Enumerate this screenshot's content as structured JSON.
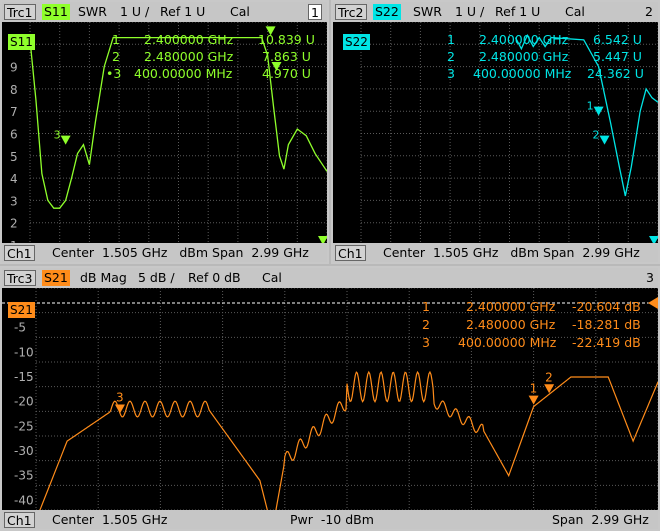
{
  "colors": {
    "s11": "#8fff2b",
    "s22": "#00e5e5",
    "s21": "#ff8c1a",
    "grid": "#5a5a5a",
    "axis": "#a0a0a0"
  },
  "p1": {
    "trace": "Trc1",
    "param": "S11",
    "format": "SWR",
    "scale": "1 U /",
    "ref": "Ref 1 U",
    "cal": "Cal",
    "num": "1",
    "badge": "S11",
    "markers": [
      {
        "id": "1",
        "freq": "2.400000 GHz",
        "val": "10.839 U"
      },
      {
        "id": "2",
        "freq": "2.480000 GHz",
        "val": "7.863 U"
      },
      {
        "id": "•3",
        "freq": "400.00000 MHz",
        "val": "4.970 U"
      }
    ],
    "ticks": [
      "9",
      "8",
      "7",
      "6",
      "5",
      "4",
      "3",
      "2",
      "1"
    ],
    "trace_points": [
      [
        0,
        10.2
      ],
      [
        0.02,
        7.5
      ],
      [
        0.04,
        4.2
      ],
      [
        0.06,
        3.0
      ],
      [
        0.08,
        2.65
      ],
      [
        0.1,
        2.65
      ],
      [
        0.12,
        3.0
      ],
      [
        0.14,
        4.0
      ],
      [
        0.16,
        5.1
      ],
      [
        0.18,
        5.5
      ],
      [
        0.2,
        4.6
      ],
      [
        0.22,
        6.5
      ],
      [
        0.25,
        9.0
      ],
      [
        0.28,
        10.3
      ],
      [
        0.78,
        10.3
      ],
      [
        0.8,
        9.5
      ],
      [
        0.82,
        7.2
      ],
      [
        0.84,
        5.0
      ],
      [
        0.855,
        4.4
      ],
      [
        0.87,
        5.5
      ],
      [
        0.9,
        6.2
      ],
      [
        0.93,
        5.9
      ],
      [
        0.96,
        5.1
      ],
      [
        0.99,
        4.5
      ],
      [
        1.0,
        4.3
      ]
    ],
    "marker_pos": [
      {
        "lbl": "",
        "x": 0.81,
        "y": 10.4
      },
      {
        "lbl": "",
        "x": 0.83,
        "y": 8.8
      },
      {
        "lbl": "3",
        "x": 0.12,
        "y": 5.5
      }
    ],
    "footer_ch": "Ch1",
    "footer": "Center  1.505 GHz   dBm Span  2.99 GHz"
  },
  "p2": {
    "trace": "Trc2",
    "param": "S22",
    "format": "SWR",
    "scale": "1 U /",
    "ref": "Ref 1 U",
    "cal": "Cal",
    "num": "2",
    "badge": "S22",
    "markers": [
      {
        "id": "1",
        "freq": "2.400000 GHz",
        "val": "6.542 U"
      },
      {
        "id": "2",
        "freq": "2.480000 GHz",
        "val": "5.447 U"
      },
      {
        "id": "3",
        "freq": "400.00000 MHz",
        "val": "24.362 U"
      }
    ],
    "trace_points": [
      [
        0.52,
        10.3
      ],
      [
        0.54,
        9.8
      ],
      [
        0.56,
        10.4
      ],
      [
        0.58,
        9.9
      ],
      [
        0.6,
        10.3
      ],
      [
        0.62,
        9.9
      ],
      [
        0.64,
        10.3
      ],
      [
        0.75,
        10.2
      ],
      [
        0.8,
        9.0
      ],
      [
        0.84,
        6.5
      ],
      [
        0.87,
        4.5
      ],
      [
        0.89,
        3.2
      ],
      [
        0.91,
        4.5
      ],
      [
        0.94,
        7.0
      ],
      [
        0.96,
        8.0
      ],
      [
        0.98,
        7.6
      ],
      [
        1.0,
        7.4
      ]
    ],
    "marker_pos": [
      {
        "lbl": "1",
        "x": 0.8,
        "y": 6.8
      },
      {
        "lbl": "2",
        "x": 0.82,
        "y": 5.5
      }
    ],
    "footer_ch": "Ch1",
    "footer": "Center  1.505 GHz   dBm Span  2.99 GHz"
  },
  "p3": {
    "trace": "Trc3",
    "param": "S21",
    "format": "dB Mag",
    "scale": "5 dB /",
    "ref": "Ref 0 dB",
    "cal": "Cal",
    "num": "3",
    "badge": "S21",
    "markers": [
      {
        "id": "1",
        "freq": "2.400000 GHz",
        "val": "-20.604 dB"
      },
      {
        "id": "2",
        "freq": "2.480000 GHz",
        "val": "-18.281 dB"
      },
      {
        "id": "3",
        "freq": "400.00000 MHz",
        "val": "-22.419 dB"
      }
    ],
    "ticks": [
      "-5",
      "-10",
      "-15",
      "-20",
      "-25",
      "-30",
      "-35",
      "-40"
    ],
    "marker_pos": [
      {
        "lbl": "3",
        "x": 0.135,
        "y": -22.4
      },
      {
        "lbl": "1",
        "x": 0.8,
        "y": -20.6
      },
      {
        "lbl": "2",
        "x": 0.825,
        "y": -18.3
      }
    ],
    "footer_ch": "Ch1",
    "footer_center": "Center  1.505 GHz",
    "footer_pwr": "Pwr  -10 dBm",
    "footer_span": "Span  2.99 GHz"
  }
}
